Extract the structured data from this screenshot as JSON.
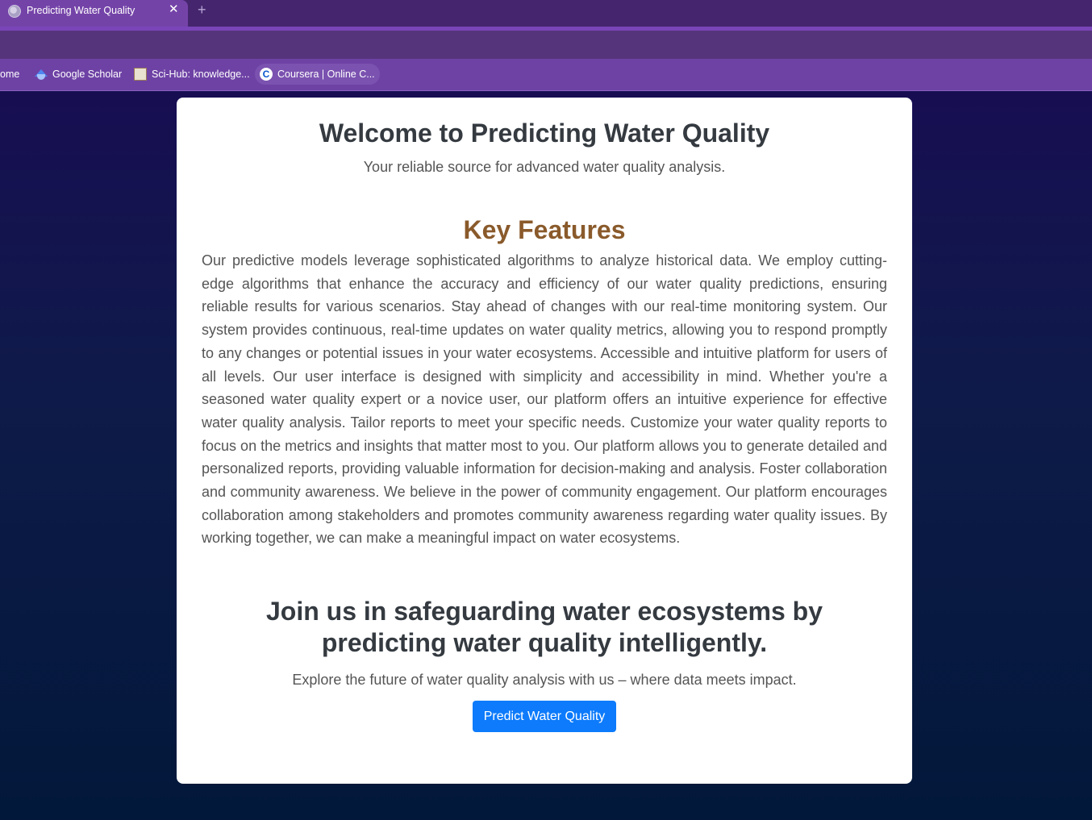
{
  "browser": {
    "tab": {
      "title": "Predicting Water Quality",
      "close_glyph": "✕",
      "favicon": "globe-icon"
    },
    "new_tab_glyph": "+",
    "bookmarks": [
      {
        "label": "ome",
        "icon": "home-icon"
      },
      {
        "label": "Google Scholar",
        "icon": "google-scholar-icon"
      },
      {
        "label": "Sci-Hub: knowledge...",
        "icon": "scihub-icon"
      },
      {
        "label": "Coursera | Online C...",
        "icon": "coursera-icon"
      }
    ],
    "colors": {
      "tabstrip": "#45266e",
      "active_tab": "#7443a8",
      "bookmarks_bar": "#6e42a5"
    }
  },
  "page": {
    "welcome_title": "Welcome to Predicting Water Quality",
    "tagline": "Your reliable source for advanced water quality analysis.",
    "features_heading": "Key Features",
    "features_body": "Our predictive models leverage sophisticated algorithms to analyze historical data. We employ cutting-edge algorithms that enhance the accuracy and efficiency of our water quality predictions, ensuring reliable results for various scenarios. Stay ahead of changes with our real-time monitoring system. Our system provides continuous, real-time updates on water quality metrics, allowing you to respond promptly to any changes or potential issues in your water ecosystems. Accessible and intuitive platform for users of all levels. Our user interface is designed with simplicity and accessibility in mind. Whether you're a seasoned water quality expert or a novice user, our platform offers an intuitive experience for effective water quality analysis. Tailor reports to meet your specific needs. Customize your water quality reports to focus on the metrics and insights that matter most to you. Our platform allows you to generate detailed and personalized reports, providing valuable information for decision-making and analysis. Foster collaboration and community awareness. We believe in the power of community engagement. Our platform encourages collaboration among stakeholders and promotes community awareness regarding water quality issues. By working together, we can make a meaningful impact on water ecosystems.",
    "join_heading": "Join us in safeguarding water ecosystems by predicting water quality intelligently.",
    "explore_text": "Explore the future of water quality analysis with us – where data meets impact.",
    "predict_button": "Predict Water Quality",
    "colors": {
      "heading": "#343a40",
      "features_heading": "#8a5a2b",
      "body_text": "#555555",
      "button": "#0d7bfb"
    }
  }
}
